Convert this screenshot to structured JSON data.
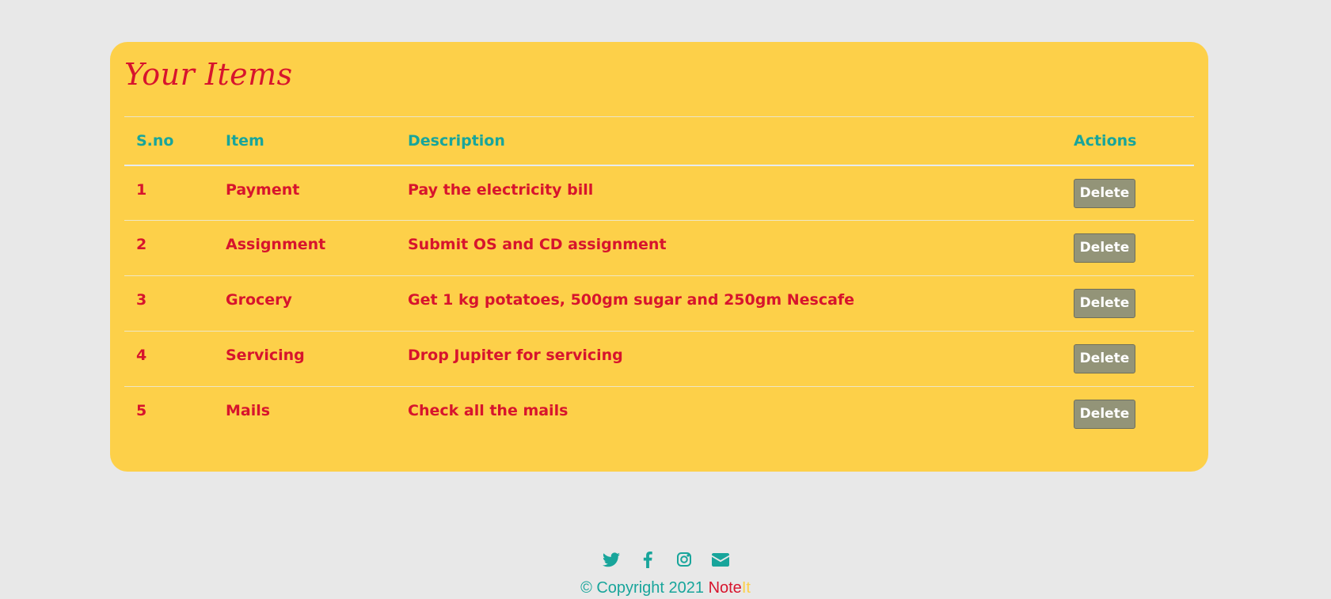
{
  "card": {
    "title": "Your Items"
  },
  "table": {
    "headers": [
      "S.no",
      "Item",
      "Description",
      "Actions"
    ],
    "rows": [
      {
        "sno": "1",
        "item": "Payment",
        "description": "Pay the electricity bill",
        "action": "Delete"
      },
      {
        "sno": "2",
        "item": "Assignment",
        "description": "Submit OS and CD assignment",
        "action": "Delete"
      },
      {
        "sno": "3",
        "item": "Grocery",
        "description": "Get 1 kg potatoes, 500gm sugar and 250gm Nescafe",
        "action": "Delete"
      },
      {
        "sno": "4",
        "item": "Servicing",
        "description": "Drop Jupiter for servicing",
        "action": "Delete"
      },
      {
        "sno": "5",
        "item": "Mails",
        "description": "Check all the mails",
        "action": "Delete"
      }
    ]
  },
  "footer": {
    "icons": [
      "twitter-icon",
      "facebook-icon",
      "instagram-icon",
      "envelope-icon"
    ],
    "copyright_prefix": "© Copyright 2021",
    "brand_part1": "Note",
    "brand_part2": "It"
  },
  "colors": {
    "page_background": "#e8e8e8",
    "card_background": "#fdd049",
    "accent_red": "#d7142d",
    "accent_teal": "#18a59b",
    "button_gray": "#939478"
  }
}
